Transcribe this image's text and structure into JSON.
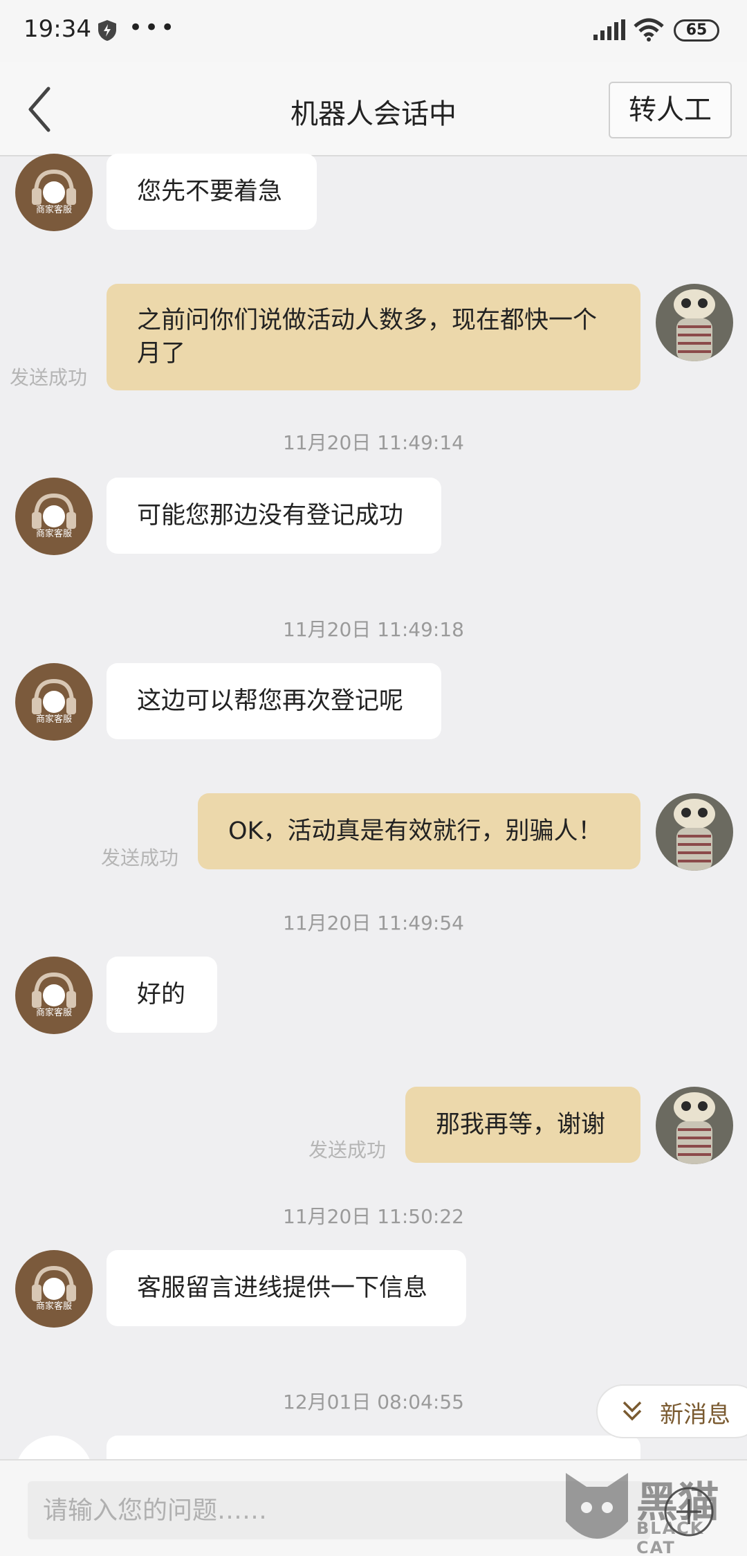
{
  "status_bar": {
    "time": "19:34",
    "dots": "•••",
    "battery": "65"
  },
  "header": {
    "title": "机器人会话中",
    "transfer_label": "转人工"
  },
  "bot": {
    "avatar_label": "商家客服"
  },
  "messages": {
    "m1": {
      "text": "您先不要着急"
    },
    "m2": {
      "text": "之前问你们说做活动人数多，现在都快一个月了",
      "status": "发送成功"
    },
    "m3": {
      "time": "11月20日 11:49:14",
      "text": "可能您那边没有登记成功"
    },
    "m4": {
      "time": "11月20日 11:49:18",
      "text": "这边可以帮您再次登记呢"
    },
    "m5": {
      "text": "OK，活动真是有效就行，别骗人！",
      "status": "发送成功"
    },
    "m6": {
      "time": "11月20日 11:49:54",
      "text": "好的"
    },
    "m7": {
      "text": "那我再等，谢谢",
      "status": "发送成功"
    },
    "m8": {
      "time": "11月20日 11:50:22",
      "text": "客服留言进线提供一下信息"
    },
    "m9": {
      "time": "12月01日 08:04:55"
    }
  },
  "new_message_label": "新消息",
  "input": {
    "placeholder": "请输入您的问题……"
  },
  "watermark": {
    "cn": "黑猫",
    "en": "BLACK CAT"
  },
  "colors": {
    "user_bubble": "#ecd8ab",
    "bot_avatar": "#7b5a3c",
    "background": "#efeff1"
  }
}
